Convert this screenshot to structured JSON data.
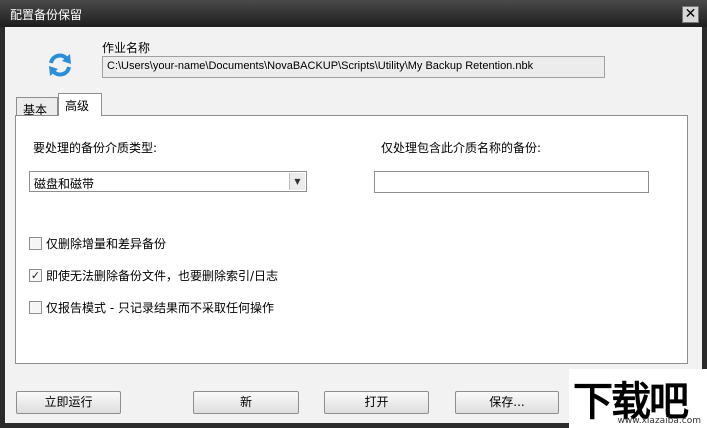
{
  "window": {
    "title": "配置备份保留",
    "close_glyph": "✕"
  },
  "job": {
    "label": "作业名称",
    "path": "C:\\Users\\your-name\\Documents\\NovaBACKUP\\Scripts\\Utility\\My Backup Retention.nbk"
  },
  "tabs": [
    {
      "label": "基本",
      "active": false
    },
    {
      "label": "高级",
      "active": true
    }
  ],
  "advanced": {
    "media_type_label": "要处理的备份介质类型:",
    "media_type_value": "磁盘和磁带",
    "media_name_label": "仅处理包含此介质名称的备份:",
    "media_name_value": "",
    "checkboxes": [
      {
        "label": "仅删除增量和差异备份",
        "checked": false,
        "mark": ""
      },
      {
        "label": "即使无法删除备份文件，也要删除索引/日志",
        "checked": true,
        "mark": "✓"
      },
      {
        "label": "仅报告模式 - 只记录结果而不采取任何操作",
        "checked": false,
        "mark": ""
      }
    ]
  },
  "buttons": {
    "run": "立即运行",
    "new": "新",
    "open": "打开",
    "save": "保存..."
  },
  "watermark": {
    "logo": "下载吧",
    "url": "www.xiazaiba.com"
  },
  "icons": {
    "app": "refresh-arrows-icon",
    "combo_arrow": "chevron-down-icon"
  },
  "colors": {
    "titlebar": "#2b2b2b",
    "icon_blue": "#2a8fd8"
  }
}
